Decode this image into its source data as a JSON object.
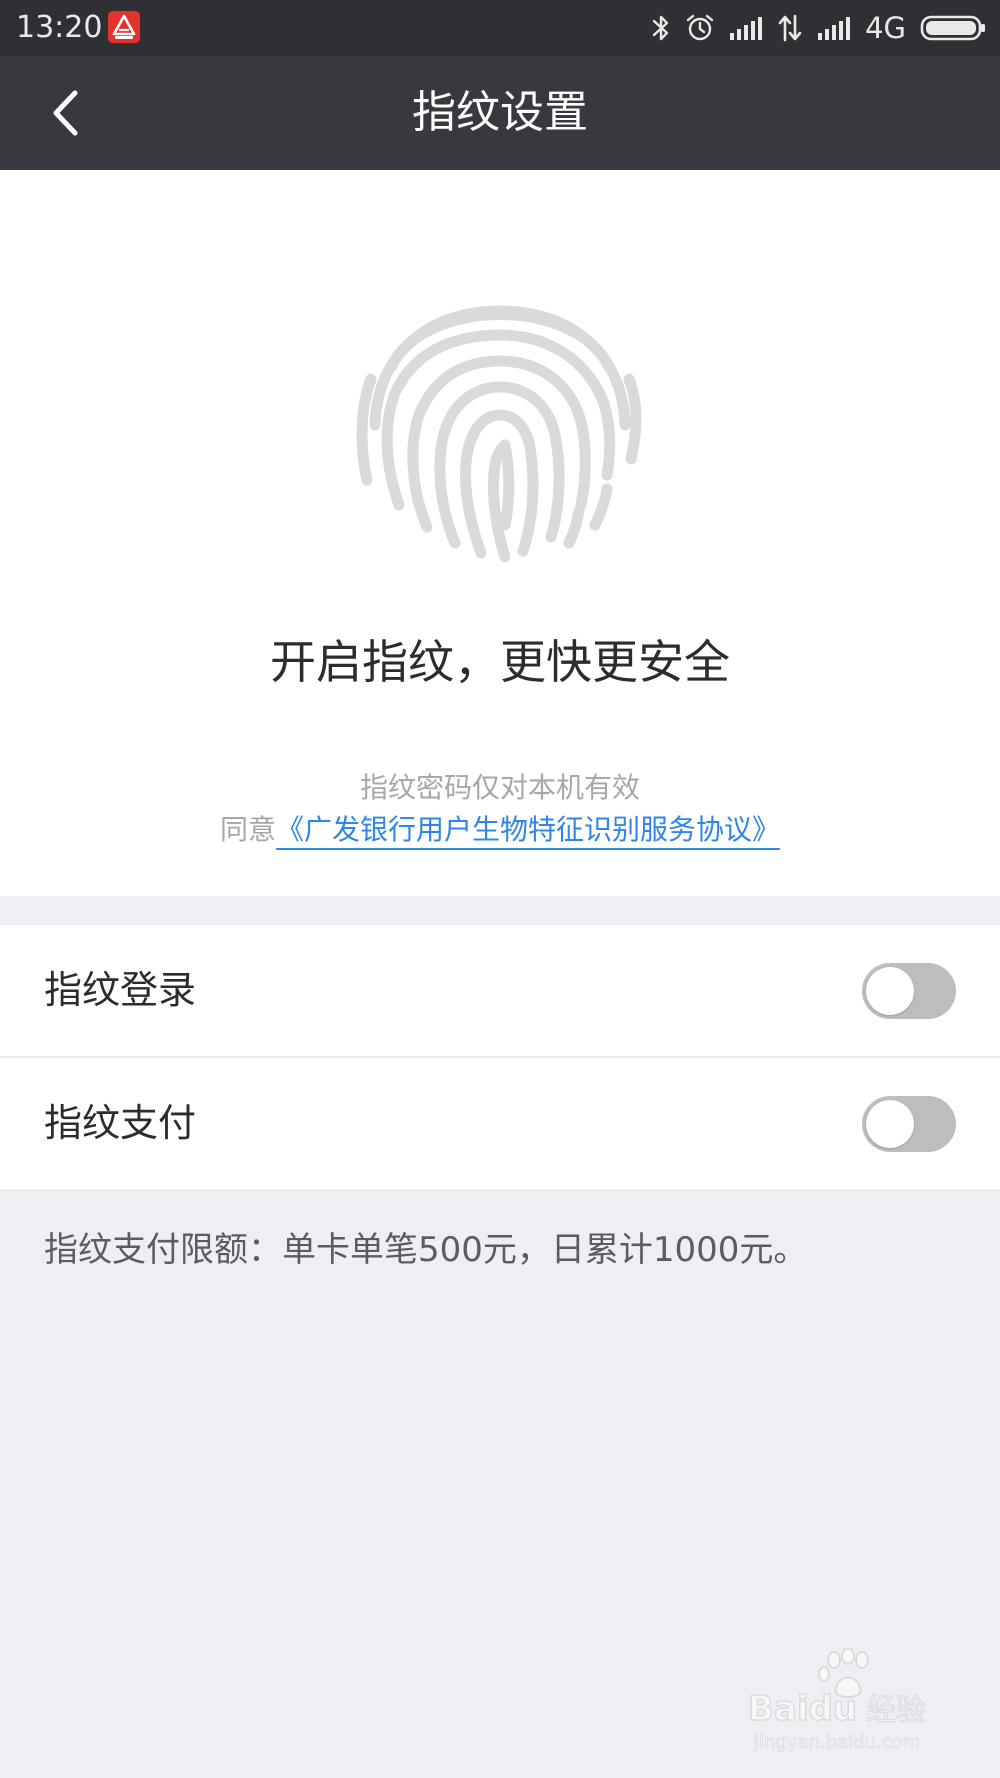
{
  "status_bar": {
    "time": "13:20",
    "network": "4G",
    "icons": [
      "app-logo-icon",
      "bluetooth-icon",
      "alarm-icon",
      "signal-icon",
      "data-transfer-icon",
      "signal-icon",
      "battery-icon"
    ]
  },
  "nav": {
    "title": "指纹设置",
    "back_icon": "chevron-left-icon"
  },
  "hero": {
    "icon": "fingerprint-icon",
    "title": "开启指纹，更快更安全",
    "note": "指纹密码仅对本机有效",
    "agreement_prefix": "同意",
    "agreement_link": "《广发银行用户生物特征识别服务协议》"
  },
  "settings": {
    "items": [
      {
        "label": "指纹登录",
        "enabled": false
      },
      {
        "label": "指纹支付",
        "enabled": false
      }
    ]
  },
  "footer": {
    "limit_note": "指纹支付限额：单卡单笔500元，日累计1000元。"
  },
  "watermark": {
    "brand": "Baidu",
    "brand_cn": "经验",
    "url": "jingyan.baidu.com"
  },
  "colors": {
    "status_bar": "#2f3034",
    "nav_bar": "#38393e",
    "link": "#2f86e8",
    "page_bg": "#efeff3",
    "toggle_off": "#bdbdc0"
  }
}
